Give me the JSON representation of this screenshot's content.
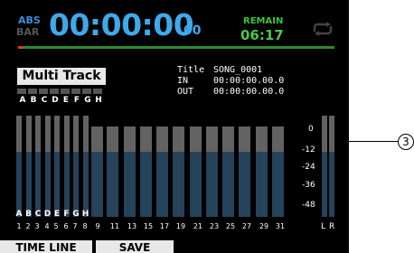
{
  "header": {
    "abs_label": "ABS",
    "bar_label": "BAR",
    "time": "00:00:00",
    "frames": "00",
    "remain_label": "REMAIN",
    "remain_value": "06:17",
    "loop_icon": "repeat-icon"
  },
  "colors": {
    "time": "#3ea9ea",
    "remain": "#39c43c",
    "progress": "#2d8a2d",
    "position_marker": "#e23a2a",
    "meter_level": "#25435a",
    "meter_headroom": "#626262"
  },
  "mode_button": "Multi Track",
  "track_letters": [
    "A",
    "B",
    "C",
    "D",
    "E",
    "F",
    "G",
    "H"
  ],
  "song_info": [
    {
      "key": "Title",
      "value": "SONG_0001"
    },
    {
      "key": "IN",
      "value": "00:00:00.00.0"
    },
    {
      "key": "OUT",
      "value": "00:00:00.00.0"
    }
  ],
  "meters": {
    "letters_row": "ABCDEFGH",
    "channel_numbers": [
      "1",
      "2",
      "3",
      "4",
      "5",
      "6",
      "7",
      "8",
      "9",
      "11",
      "13",
      "15",
      "17",
      "19",
      "21",
      "23",
      "25",
      "27",
      "29",
      "31"
    ],
    "scale": [
      "0",
      "-12",
      "-24",
      "-36",
      "-48"
    ],
    "stereo_labels": [
      "L",
      "R"
    ]
  },
  "softkeys": [
    "TIME LINE",
    "SAVE"
  ],
  "callout": "3"
}
